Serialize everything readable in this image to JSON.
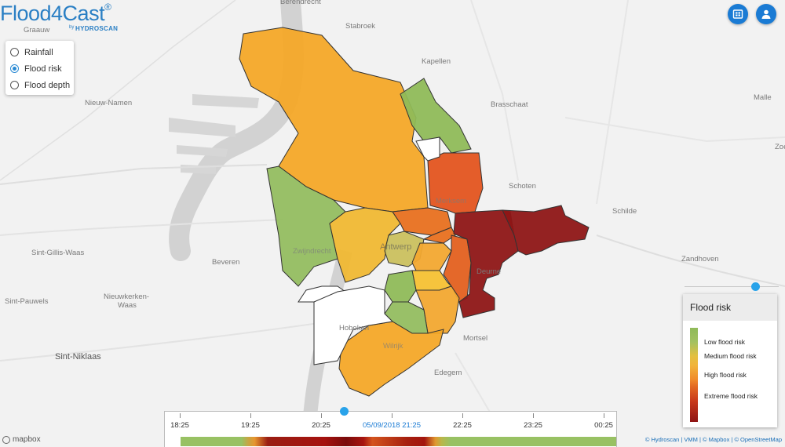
{
  "brand": {
    "name": "Flood4Cast",
    "reg": "®",
    "by": "by",
    "partner": "HYDROSCAN"
  },
  "layers": [
    {
      "label": "Rainfall",
      "checked": false
    },
    {
      "label": "Flood risk",
      "checked": true
    },
    {
      "label": "Flood depth",
      "checked": false
    }
  ],
  "toolbar": {
    "dashboard_icon": "dashboard-icon",
    "user_icon": "user-icon"
  },
  "places": {
    "berendrecht": "Berendrecht",
    "graauw": "Graauw",
    "stabroek": "Stabroek",
    "kapellen": "Kapellen",
    "brasschaat": "Brasschaat",
    "malle": "Malle",
    "nieuw_namen": "Nieuw-Namen",
    "schoten": "Schoten",
    "zoersel": "Zoe",
    "merksem": "Merksem",
    "schilde": "Schilde",
    "sint_gillis": "Sint-Gillis-Waas",
    "zwijndrecht": "Zwijndrecht",
    "antwerp": "Antwerp",
    "zandhoven": "Zandhoven",
    "beveren": "Beveren",
    "deurne": "Deurne",
    "sint_pauwels": "Sint-Pauwels",
    "nieuwkerken": "Nieuwkerken-",
    "nieuwkerken2": "Waas",
    "hoboken": "Hoboken",
    "mortsel": "Mortsel",
    "sint_niklaas": "Sint-Niklaas",
    "wilrijk": "Wilrijk",
    "edegem": "Edegem"
  },
  "legend": {
    "title": "Flood risk",
    "items": [
      "Low flood risk",
      "Medium flood risk",
      "High flood risk",
      "Extreme flood risk"
    ]
  },
  "colors": {
    "low": "#8fba59",
    "medium": "#f2b233",
    "high": "#e3541f",
    "extreme": "#8e1616",
    "accent": "#1a7bd4"
  },
  "timeline": {
    "ticks": [
      "18:25",
      "19:25",
      "20:25",
      "05/09/2018 21:25",
      "22:25",
      "23:25",
      "00:25"
    ],
    "current_index": 3
  },
  "attribution": "© Hydroscan | VMM | © Mapbox | © OpenStreetMap",
  "mapbox": "mapbox"
}
